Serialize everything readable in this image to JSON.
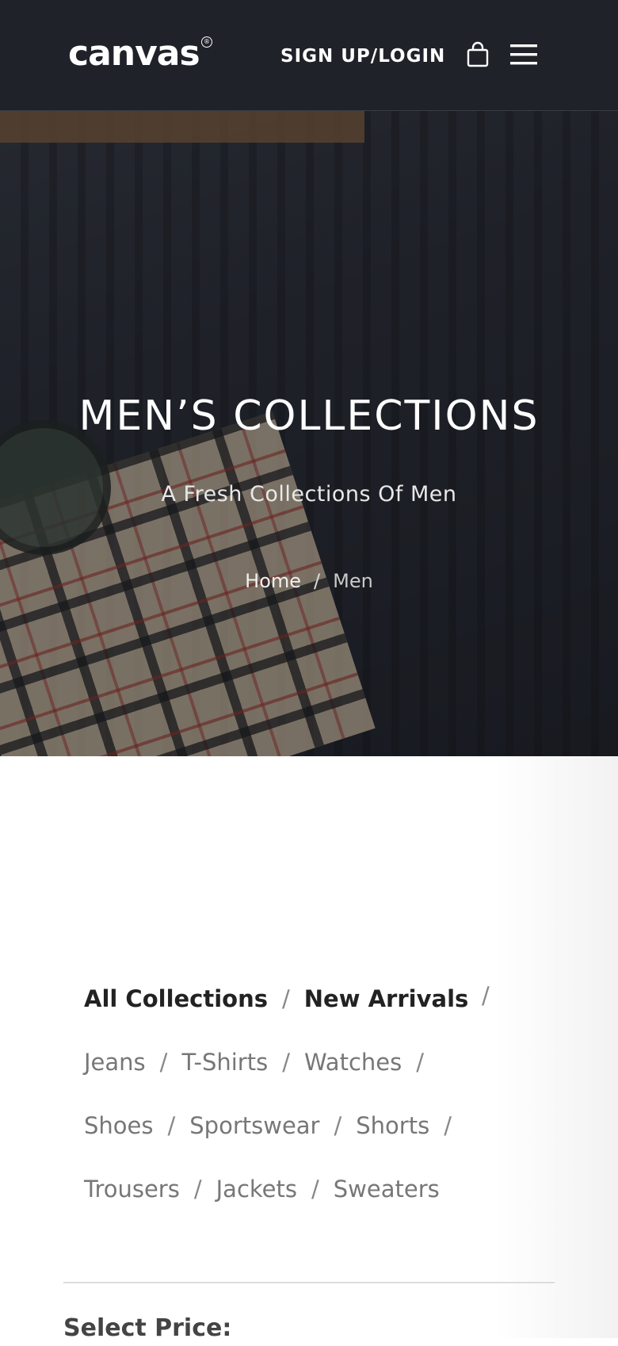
{
  "header": {
    "logo": "canvas",
    "logo_mark": "®",
    "signup_label": "SIGN UP/LOGIN",
    "cart_icon": "shopping-bag-icon",
    "menu_icon": "hamburger-menu-icon"
  },
  "hero": {
    "title": "MEN’S COLLECTIONS",
    "subtitle": "A Fresh Collections Of Men",
    "breadcrumb": {
      "home": "Home",
      "separator": "/",
      "current": "Men"
    }
  },
  "collections": {
    "separator": "/",
    "featured": [
      "All Collections",
      "New Arrivals"
    ],
    "categories": [
      "Jeans",
      "T-Shirts",
      "Watches",
      "Shoes",
      "Sportswear",
      "Shorts",
      "Trousers",
      "Jackets",
      "Sweaters"
    ]
  },
  "filters": {
    "price_title": "Select Price:"
  },
  "colors": {
    "header_bg": "#1f2228",
    "text_dark": "#222222",
    "text_muted": "#777777"
  }
}
